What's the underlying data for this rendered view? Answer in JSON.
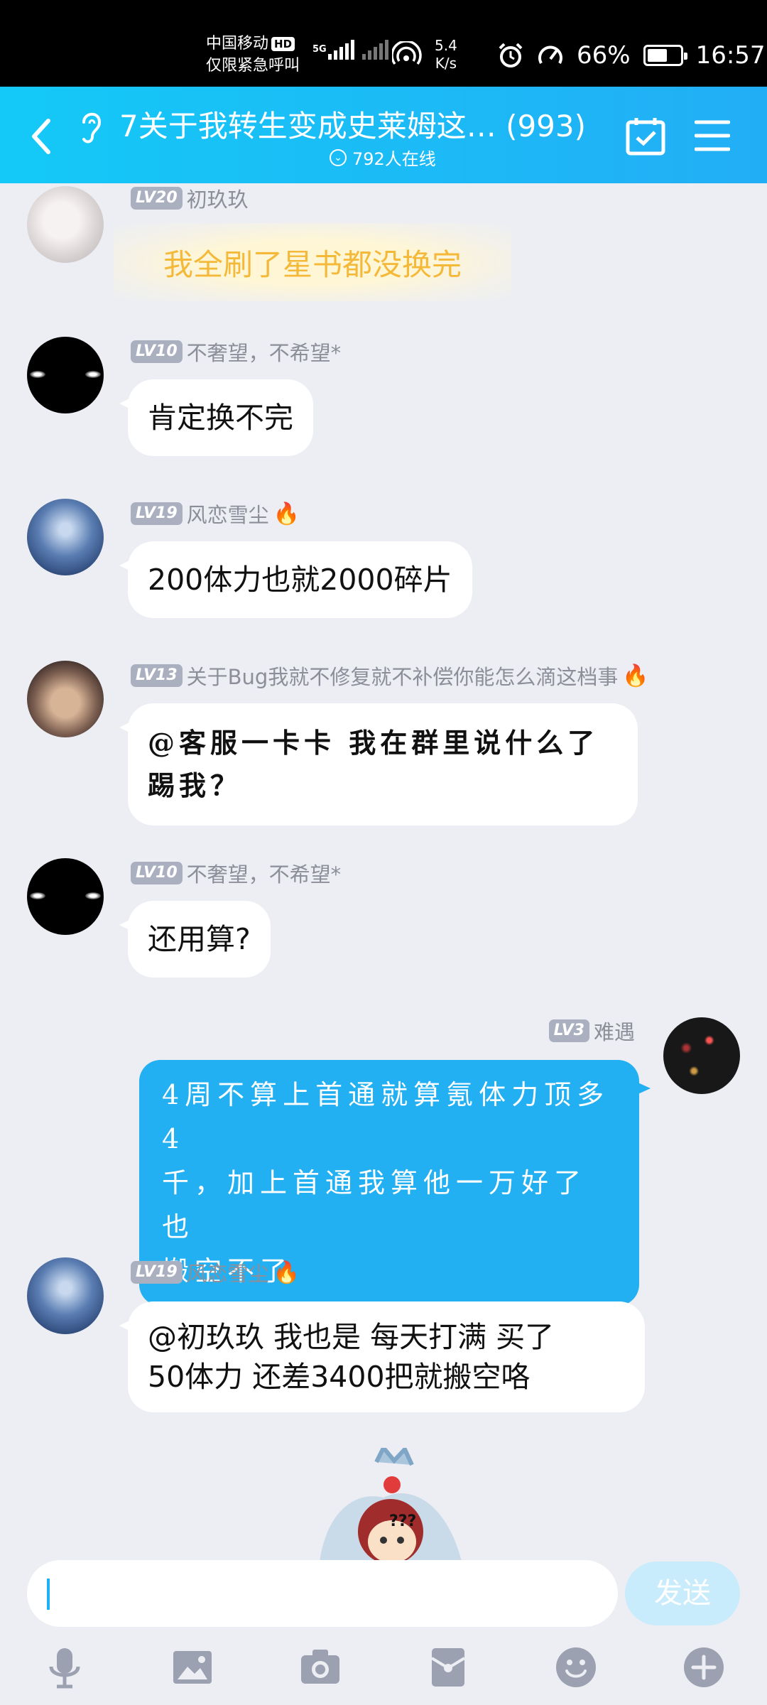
{
  "status_bar": {
    "carrier": "中国移动",
    "hd": "HD",
    "emergency": "仅限紧急呼叫",
    "net_type": "5G",
    "speed_value": "5.4",
    "speed_unit": "K/s",
    "battery_percent": "66%",
    "battery_level": 0.66,
    "time": "16:57"
  },
  "header": {
    "title": "7关于我转生变成史莱姆这… (993)",
    "online": "792人在线"
  },
  "messages": [
    {
      "level": "LV20",
      "name": "初玖玖",
      "text": "我全刷了星书都没换完"
    },
    {
      "level": "LV10",
      "name": "不奢望，不希望*",
      "text": "肯定换不完"
    },
    {
      "level": "LV19",
      "name": "风恋雪尘",
      "text": "200体力也就2000碎片"
    },
    {
      "level": "LV13",
      "name": "关于Bug我就不修复就不补偿你能怎么滴这档事",
      "text_line1": "@客服一卡卡 我在群里说什么了",
      "text_line2": "踢我？"
    },
    {
      "level": "LV10",
      "name": "不奢望，不希望*",
      "text": "还用算?"
    },
    {
      "level": "LV3",
      "name": "难遇",
      "text_line1": "4周不算上首通就算氪体力顶多4",
      "text_line2": "千，加上首通我算他一万好了也",
      "text_line3": "搬空不了"
    },
    {
      "level": "LV19",
      "name": "风恋雪尘",
      "text_line1": "@初玖玖 我也是 每天打满 买了",
      "text_line2": "50体力 还差3400把就搬空咯"
    }
  ],
  "sticker_text": "???",
  "input": {
    "value": "",
    "send_label": "发送"
  },
  "toolbar": [
    "mic-icon",
    "image-icon",
    "camera-icon",
    "red-packet-icon",
    "emoji-icon",
    "plus-icon"
  ],
  "colors": {
    "header": "#1ab8f4",
    "my_bubble": "#22b0f2",
    "chat_bg": "#eceef4",
    "special_text": "#f5b93a"
  }
}
